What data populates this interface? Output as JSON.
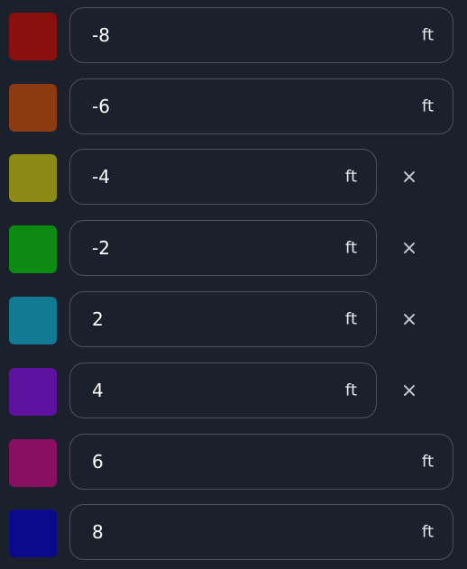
{
  "rows": [
    {
      "value": "-8",
      "unit": "ft",
      "color": "#8c0f0f",
      "removable": false
    },
    {
      "value": "-6",
      "unit": "ft",
      "color": "#8c3a10",
      "removable": false
    },
    {
      "value": "-4",
      "unit": "ft",
      "color": "#8a8a14",
      "removable": true
    },
    {
      "value": "-2",
      "unit": "ft",
      "color": "#0d8a12",
      "removable": true
    },
    {
      "value": "2",
      "unit": "ft",
      "color": "#137a93",
      "removable": true
    },
    {
      "value": "4",
      "unit": "ft",
      "color": "#5e129e",
      "removable": true
    },
    {
      "value": "6",
      "unit": "ft",
      "color": "#8a0f63",
      "removable": false
    },
    {
      "value": "8",
      "unit": "ft",
      "color": "#0a0a8a",
      "removable": false
    }
  ],
  "remove_label": "×"
}
